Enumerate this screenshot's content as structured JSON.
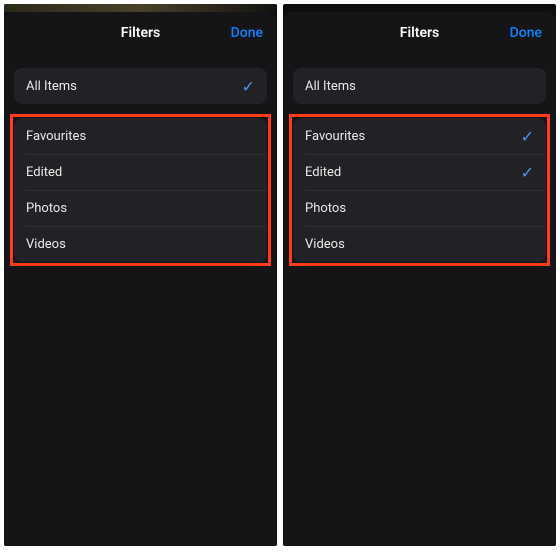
{
  "screens": [
    {
      "id": "left",
      "header": {
        "title": "Filters",
        "done": "Done"
      },
      "groups": [
        {
          "items": [
            {
              "label": "All Items",
              "checked": true
            }
          ]
        },
        {
          "highlight": true,
          "items": [
            {
              "label": "Favourites",
              "checked": false
            },
            {
              "label": "Edited",
              "checked": false
            },
            {
              "label": "Photos",
              "checked": false
            },
            {
              "label": "Videos",
              "checked": false
            }
          ]
        }
      ]
    },
    {
      "id": "right",
      "header": {
        "title": "Filters",
        "done": "Done"
      },
      "groups": [
        {
          "items": [
            {
              "label": "All Items",
              "checked": false
            }
          ]
        },
        {
          "highlight": true,
          "items": [
            {
              "label": "Favourites",
              "checked": true
            },
            {
              "label": "Edited",
              "checked": true
            },
            {
              "label": "Photos",
              "checked": false
            },
            {
              "label": "Videos",
              "checked": false
            }
          ]
        }
      ]
    }
  ],
  "icons": {
    "check": "✓"
  }
}
